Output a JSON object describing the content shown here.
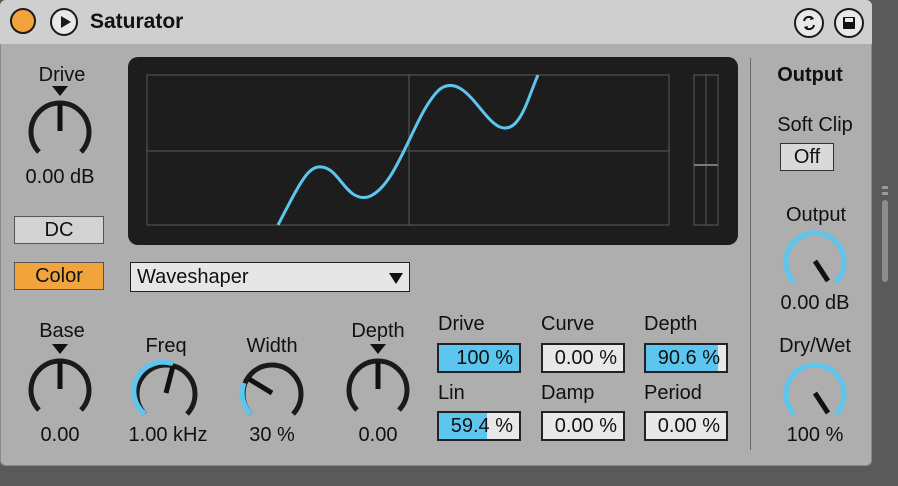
{
  "device": {
    "title": "Saturator"
  },
  "left": {
    "drive_label": "Drive",
    "drive_value": "0.00 dB",
    "dc_button": "DC",
    "color_button": "Color"
  },
  "shaper": {
    "type_selected": "Waveshaper"
  },
  "color_section": {
    "base_label": "Base",
    "base_value": "0.00",
    "freq_label": "Freq",
    "freq_value": "1.00 kHz",
    "width_label": "Width",
    "width_value": "30 %",
    "depth_label": "Depth",
    "depth_value": "0.00"
  },
  "waveshaper_params": {
    "drive_label": "Drive",
    "drive_value": "100 %",
    "drive_fill": 1.0,
    "curve_label": "Curve",
    "curve_value": "0.00 %",
    "depth_label": "Depth",
    "depth_value": "90.6 %",
    "depth_fill": 0.906,
    "lin_label": "Lin",
    "lin_value": "59.4 %",
    "lin_fill": 0.594,
    "damp_label": "Damp",
    "damp_value": "0.00 %",
    "period_label": "Period",
    "period_value": "0.00 %"
  },
  "output_section": {
    "heading": "Output",
    "soft_clip_label": "Soft Clip",
    "soft_clip_value": "Off",
    "output_label": "Output",
    "output_value": "0.00 dB",
    "drywet_label": "Dry/Wet",
    "drywet_value": "100 %"
  },
  "colors": {
    "accent_blue": "#5cc6ee",
    "accent_orange": "#f2a43c",
    "panel": "#aeaeae"
  },
  "icons": [
    "power-icon",
    "play-icon",
    "hot-swap-icon",
    "save-preset-icon"
  ]
}
